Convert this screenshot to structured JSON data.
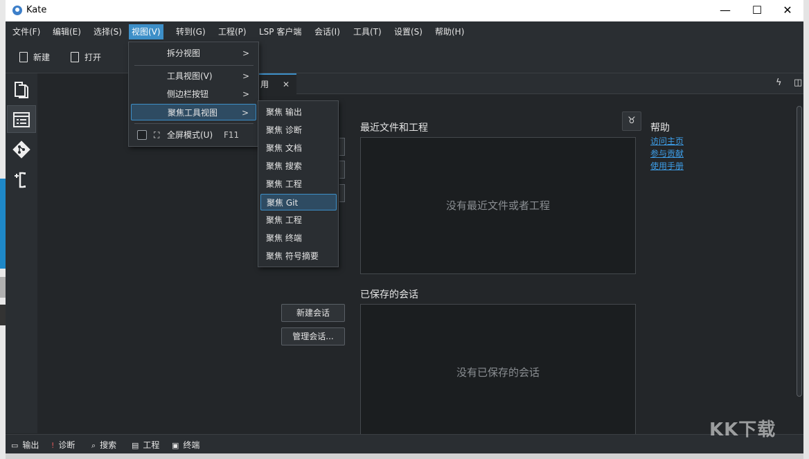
{
  "window": {
    "title": "Kate"
  },
  "window_controls": {
    "minimize": "—",
    "maximize": "☐",
    "close": "✕"
  },
  "menubar": {
    "items": [
      "文件(F)",
      "编辑(E)",
      "选择(S)",
      "视图(V)",
      "转到(G)",
      "工程(P)",
      "LSP 客户端",
      "会话(I)",
      "工具(T)",
      "设置(S)",
      "帮助(H)"
    ],
    "active_index": 3
  },
  "toolbar": {
    "new_label": "新建",
    "open_label": "打开"
  },
  "tab": {
    "label": "用",
    "close": "✕"
  },
  "welcome": {
    "recent_title": "最近文件和工程",
    "recent_empty": "没有最近文件或者工程",
    "sessions_title": "已保存的会话",
    "sessions_empty": "没有已保存的会话",
    "new_session": "新建会话",
    "manage_sessions": "管理会话...",
    "help_title": "帮助",
    "help_links": [
      "访问主页",
      "参与贡献",
      "使用手册"
    ]
  },
  "view_menu": {
    "items": [
      {
        "label": "拆分视图",
        "submenu": true
      },
      {
        "label": "工具视图(V)",
        "submenu": true
      },
      {
        "label": "侧边栏按钮",
        "submenu": true
      },
      {
        "label": "聚焦工具视图",
        "submenu": true,
        "highlighted": true
      },
      {
        "label": "全屏模式(U)",
        "shortcut": "F11",
        "checkbox": true,
        "checked": false
      }
    ]
  },
  "focus_submenu": {
    "items": [
      "聚焦 输出",
      "聚焦 诊断",
      "聚焦 文档",
      "聚焦 搜索",
      "聚焦 工程",
      "聚焦 Git",
      "聚焦 工程",
      "聚焦 终端",
      "聚焦 符号摘要"
    ],
    "highlighted_index": 5
  },
  "statusbar": {
    "items": [
      {
        "label": "输出",
        "icon": "comment-icon"
      },
      {
        "label": "诊断",
        "icon": "warning-icon"
      },
      {
        "label": "搜索",
        "icon": "search-icon"
      },
      {
        "label": "工程",
        "icon": "project-icon"
      },
      {
        "label": "终端",
        "icon": "terminal-icon"
      }
    ]
  },
  "watermark": "KK下载"
}
